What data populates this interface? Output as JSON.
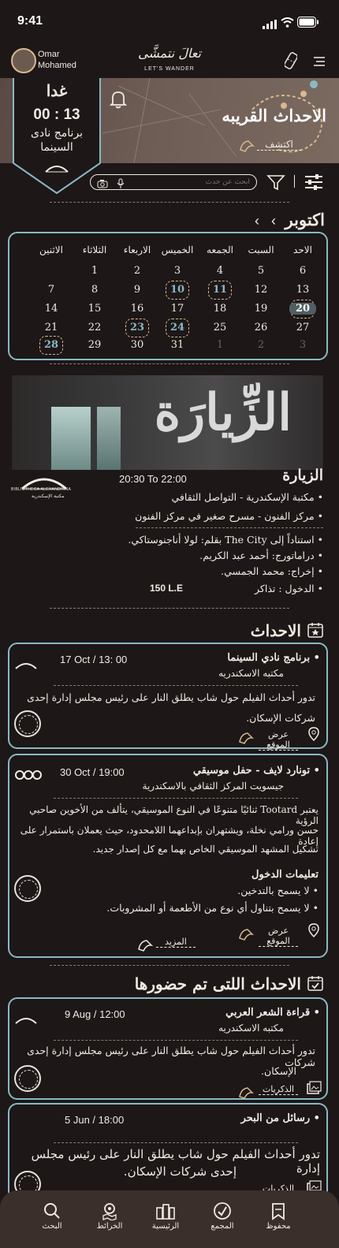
{
  "status_bar": {
    "time": "9:41"
  },
  "header": {
    "user_name_line1": "Omar",
    "user_name_line2": "Mohamed",
    "logo_text": "LET'S WANDER",
    "logo_arabic": "تعالَ نتمشَّى"
  },
  "countdown": {
    "day": "غدا",
    "time": "00 : 13",
    "program_line1": "برنامج نادى",
    "program_line2": "السينما"
  },
  "hero": {
    "title": "الاحداث القريبه",
    "explore_label": "اكتشف"
  },
  "search": {
    "placeholder": "ابحث عن حدث"
  },
  "calendar": {
    "month": "اكتوبر",
    "weekdays": [
      "الاحد",
      "السبت",
      "الجمعه",
      "الخميس",
      "الاربعاء",
      "الثلاثاء",
      "الاثنين"
    ],
    "rows": [
      [
        "6",
        "5",
        "4",
        "3",
        "2",
        "1",
        ""
      ],
      [
        "13",
        "12",
        "11",
        "10",
        "9",
        "8",
        "7"
      ],
      [
        "20",
        "19",
        "18",
        "17",
        "16",
        "15",
        "14"
      ],
      [
        "27",
        "26",
        "25",
        "24",
        "23",
        "22",
        "21"
      ],
      [
        "3",
        "2",
        "1",
        "31",
        "30",
        "29",
        "28"
      ]
    ]
  },
  "featured": {
    "banner_text": "الزِّيارَة",
    "title": "الزيارة",
    "time": "20:30  To  22:00",
    "lines": [
      "مكتبة الإسكندرية - التواصل الثقافي",
      "مركز الفنون - مسرح صغير في مركز الفنون",
      "استناداً إلى The City بقلم: لولا أناجنوستاكي.",
      "دراماتورج: أحمد عبد الكريم.",
      "إخراج: محمد الجمسي.",
      "الدخول : تذاكر"
    ],
    "price": "150 L.E",
    "partner": "BIBLIOTHECA ALEXANDRINA",
    "partner_ar": "مكتبة الإسكندرية"
  },
  "events_section": {
    "title": "الاحداث"
  },
  "events": [
    {
      "title": "برنامج نادي السينما",
      "venue": "مكتبه الاسكندريه",
      "date": "17 Oct / 13: 00",
      "desc_line1": "تدور أحداث الفيلم حول شاب يطلق النار على رئيس مجلس إدارة إحدى",
      "desc_line2": "شركات الإسكان.",
      "location_btn": "عرض الموقع"
    },
    {
      "title": "تونارد لايف - حفل موسيقي",
      "venue": "جيسويت المركز الثقافي بالاسكندرية",
      "date": "30 Oct  /  19:00",
      "desc_line1": "يعتبر Tootard ثنائيًا متنوعًا في النوع الموسيقي، يتألف من الأخوين صاحبي الرؤية",
      "desc_line2": "حسن ورامي نخلة، ويشتهران بإبداعهما اللامحدود، حيث يعملان باستمرار على إعادة",
      "desc_line3": "تشكيل المشهد الموسيقي الخاص بهما مع كل إصدار جديد.",
      "instructions_title": "تعليمات الدخول",
      "rule1": "لا يسمح بالتدخين.",
      "rule2": "لا يسمح بتناول أي نوع من الأطعمة أو المشروبات.",
      "location_btn": "عرض الموقع",
      "more_btn": "المزيد"
    }
  ],
  "attended_section": {
    "title": "الاحداث اللتى تم حضورها"
  },
  "attended": [
    {
      "title": "قراءة الشعر العربي",
      "venue": "مكتبه الاسكندريه",
      "date": "9 Aug / 12:00",
      "desc_line1": "تدور أحداث الفيلم حول شاب يطلق النار على رئيس مجلس إدارة إحدى شركات",
      "desc_line2": "الإسكان.",
      "memories_btn": "الذكريات"
    },
    {
      "title": "رسائل من البحر",
      "date": "5  Jun / 18:00",
      "desc_line1": "تدور أحداث الفيلم حول شاب يطلق النار على رئيس مجلس إدارة",
      "desc_line2": "إحدى شركات الإسكان.",
      "memories_btn": "الذكريات"
    }
  ],
  "bottom_nav": [
    {
      "label": "البحث",
      "icon": "search-icon"
    },
    {
      "label": "الخرائط",
      "icon": "map-icon"
    },
    {
      "label": "الرئيسية",
      "icon": "home-icon"
    },
    {
      "label": "المجمع",
      "icon": "compass-icon"
    },
    {
      "label": "محفوظ",
      "icon": "bookmark-icon"
    }
  ],
  "colors": {
    "background": "#1d1717",
    "accent": "#8ab8c4",
    "text": "#f1ebe4",
    "gold": "#d8b891"
  }
}
